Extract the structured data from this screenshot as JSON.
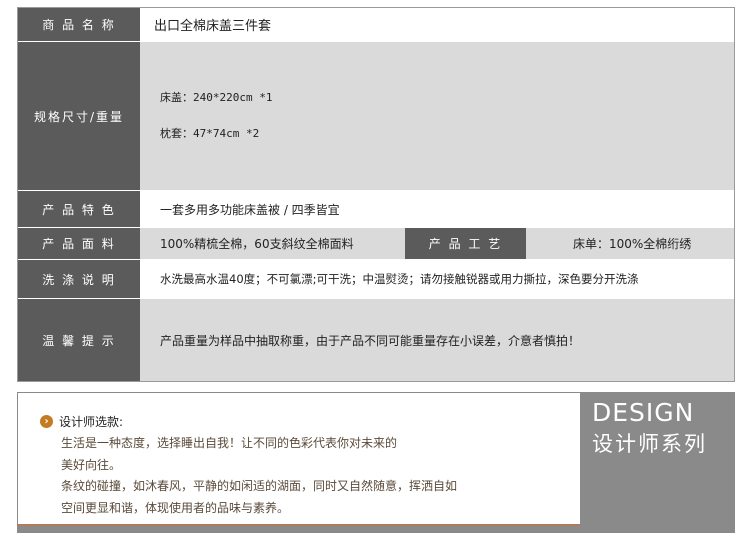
{
  "spec": {
    "name_label": "商 品 名 称",
    "name_value": "出口全棉床盖三件套",
    "size_label": "规格尺寸/重量",
    "size_lines": [
      "床盖：240*220cm *1",
      "枕套：47*74cm *2"
    ],
    "feature_label": "产 品 特 色",
    "feature_value": "一套多用多功能床盖被 / 四季皆宜",
    "fabric_label": "产 品 面 料",
    "fabric_value": "100%精梳全棉，60支斜纹全棉面料",
    "craft_label": "产 品 工 艺",
    "craft_value": "床单：100%全棉绗绣",
    "wash_label": "洗 涤 说 明",
    "wash_value": "水洗最高水温40度；不可氯漂;可干洗；中温熨烫；请勿接触锐器或用力撕拉，深色要分开洗涤",
    "tips_label": "温 馨 提 示",
    "tips_value": "产品重量为样品中抽取称重，由于产品不同可能重量存在小误差，介意者慎拍！"
  },
  "designer": {
    "title": "设计师选款:",
    "lines": [
      "生活是一种态度，选择睡出自我！让不同的色彩代表你对未来的",
      "美好向往。",
      "条纹的碰撞，如沐春风，平静的如闲适的湖面，同时又自然随意，挥洒自如",
      "空间更显和谐，体现使用者的品味与素养。"
    ],
    "brand_en": "DESIGN",
    "brand_cn": "设计师系列"
  }
}
